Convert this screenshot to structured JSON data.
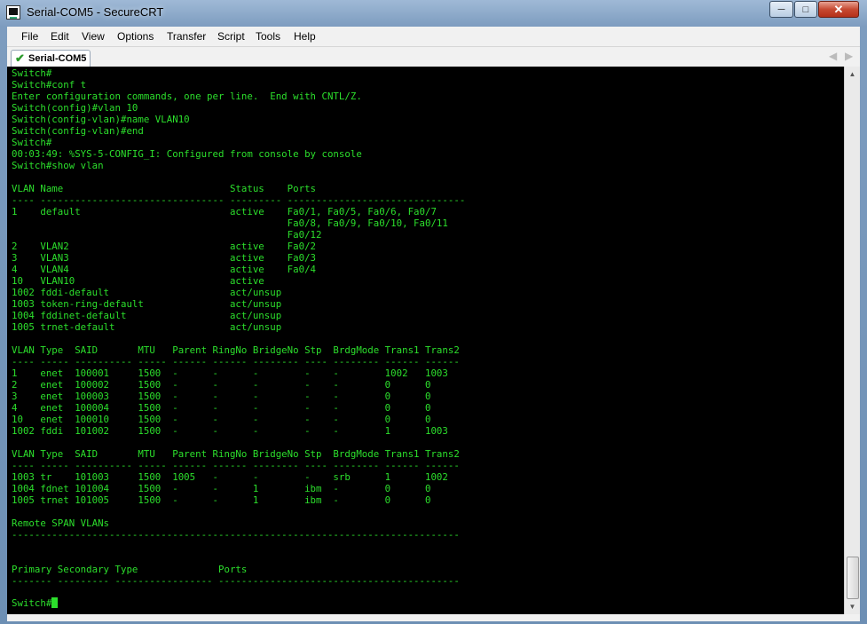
{
  "window": {
    "title": "Serial-COM5 - SecureCRT"
  },
  "menu": [
    "File",
    "Edit",
    "View",
    "Options",
    "Transfer",
    "Script",
    "Tools",
    "Help"
  ],
  "tab": {
    "label": "Serial-COM5"
  },
  "terminal": {
    "color": "#2cdf2c",
    "background": "#000000",
    "lines": [
      "Switch#",
      "Switch#conf t",
      "Enter configuration commands, one per line.  End with CNTL/Z.",
      "Switch(config)#vlan 10",
      "Switch(config-vlan)#name VLAN10",
      "Switch(config-vlan)#end",
      "Switch#",
      "00:03:49: %SYS-5-CONFIG_I: Configured from console by console",
      "Switch#show vlan",
      "",
      "VLAN Name                             Status    Ports",
      "---- -------------------------------- --------- -------------------------------",
      "1    default                          active    Fa0/1, Fa0/5, Fa0/6, Fa0/7",
      "                                                Fa0/8, Fa0/9, Fa0/10, Fa0/11",
      "                                                Fa0/12",
      "2    VLAN2                            active    Fa0/2",
      "3    VLAN3                            active    Fa0/3",
      "4    VLAN4                            active    Fa0/4",
      "10   VLAN10                           active",
      "1002 fddi-default                     act/unsup",
      "1003 token-ring-default               act/unsup",
      "1004 fddinet-default                  act/unsup",
      "1005 trnet-default                    act/unsup",
      "",
      "VLAN Type  SAID       MTU   Parent RingNo BridgeNo Stp  BrdgMode Trans1 Trans2",
      "---- ----- ---------- ----- ------ ------ -------- ---- -------- ------ ------",
      "1    enet  100001     1500  -      -      -        -    -        1002   1003",
      "2    enet  100002     1500  -      -      -        -    -        0      0",
      "3    enet  100003     1500  -      -      -        -    -        0      0",
      "4    enet  100004     1500  -      -      -        -    -        0      0",
      "10   enet  100010     1500  -      -      -        -    -        0      0",
      "1002 fddi  101002     1500  -      -      -        -    -        1      1003",
      "",
      "VLAN Type  SAID       MTU   Parent RingNo BridgeNo Stp  BrdgMode Trans1 Trans2",
      "---- ----- ---------- ----- ------ ------ -------- ---- -------- ------ ------",
      "1003 tr    101003     1500  1005   -      -        -    srb      1      1002",
      "1004 fdnet 101004     1500  -      -      1        ibm  -        0      0",
      "1005 trnet 101005     1500  -      -      1        ibm  -        0      0",
      "",
      "Remote SPAN VLANs",
      "------------------------------------------------------------------------------",
      "",
      "",
      "Primary Secondary Type              Ports",
      "------- --------- ----------------- ------------------------------------------"
    ],
    "prompt": "Switch#"
  }
}
